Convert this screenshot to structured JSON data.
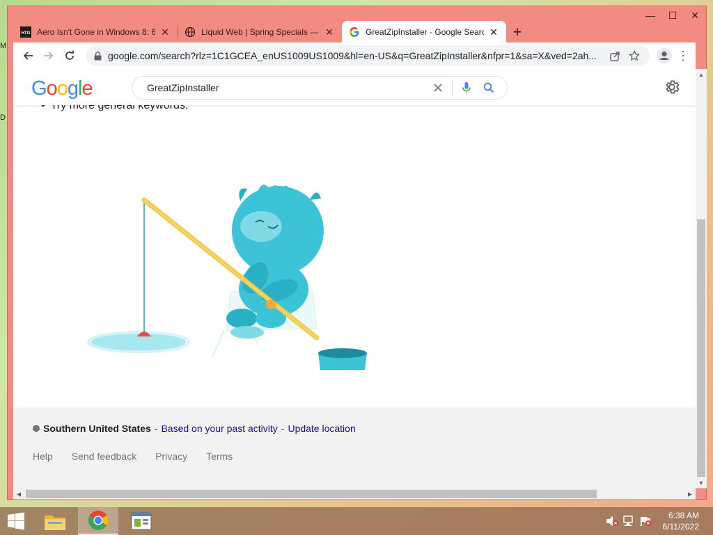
{
  "desktop": {
    "glyphs": [
      "M",
      "D"
    ]
  },
  "browser": {
    "tabs": [
      {
        "title": "Aero Isn't Gone in Windows 8: 6",
        "favicon": "htg-icon",
        "favicon_text": "HTG",
        "active": false
      },
      {
        "title": "Liquid Web | Spring Specials — I",
        "favicon": "globe-icon",
        "active": false
      },
      {
        "title": "GreatZipInstaller - Google Search",
        "favicon": "google-g-icon",
        "active": true
      }
    ],
    "new_tab": "+",
    "url": "google.com/search?rlz=1C1GCEA_enUS1009US1009&hl=en-US&q=GreatZipInstaller&nfpr=1&sa=X&ved=2ah...",
    "window_controls": {
      "minimize": "—",
      "maximize": "☐",
      "close": "✕"
    },
    "frame_color": "#f28b82"
  },
  "google": {
    "logo": [
      "G",
      "o",
      "o",
      "g",
      "l",
      "e"
    ],
    "logo_colors": [
      "#4285f4",
      "#ea4335",
      "#fbbc05",
      "#4285f4",
      "#34a853",
      "#ea4335"
    ],
    "search_query": "GreatZipInstaller",
    "tip": "Try more general keywords.",
    "footer": {
      "region": "Southern United States",
      "separator": "-",
      "based_on": "Based on your past activity",
      "update_location": "Update location",
      "links": [
        "Help",
        "Send feedback",
        "Privacy",
        "Terms"
      ]
    }
  },
  "taskbar": {
    "apps": [
      "file-explorer-icon",
      "chrome-icon",
      "control-panel-icon"
    ],
    "active_app": "chrome-icon",
    "time": "6:38 AM",
    "date": "6/11/2022"
  }
}
